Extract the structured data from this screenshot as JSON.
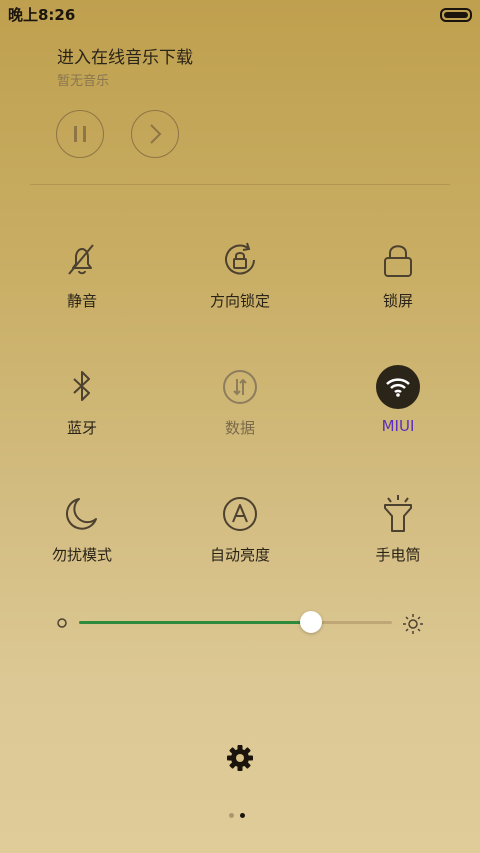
{
  "status_bar": {
    "time": "晚上8:26",
    "battery_level": 1.0
  },
  "music": {
    "title": "进入在线音乐下载",
    "subtitle": "暂无音乐",
    "pause_icon": "pause-icon",
    "next_icon": "chevron-right-icon"
  },
  "toggles": [
    {
      "label": "静音",
      "icon": "bell-off-icon",
      "state": "off"
    },
    {
      "label": "方向锁定",
      "icon": "rotation-lock-icon",
      "state": "off"
    },
    {
      "label": "锁屏",
      "icon": "lock-icon",
      "state": "off"
    },
    {
      "label": "蓝牙",
      "icon": "bluetooth-icon",
      "state": "off"
    },
    {
      "label": "数据",
      "icon": "mobile-data-icon",
      "state": "disabled"
    },
    {
      "label": "MIUI",
      "icon": "wifi-icon",
      "state": "on"
    },
    {
      "label": "勿扰模式",
      "icon": "moon-icon",
      "state": "off"
    },
    {
      "label": "自动亮度",
      "icon": "auto-brightness-icon",
      "state": "off"
    },
    {
      "label": "手电筒",
      "icon": "flashlight-icon",
      "state": "off"
    }
  ],
  "brightness": {
    "level": 0.74
  },
  "settings_icon": "gear-icon",
  "pager": {
    "count": 2,
    "active": 1
  },
  "colors": {
    "active_label": "#5a2fbf",
    "slider_fill": "#2e8b3e",
    "wifi_bg": "#2b2418"
  }
}
